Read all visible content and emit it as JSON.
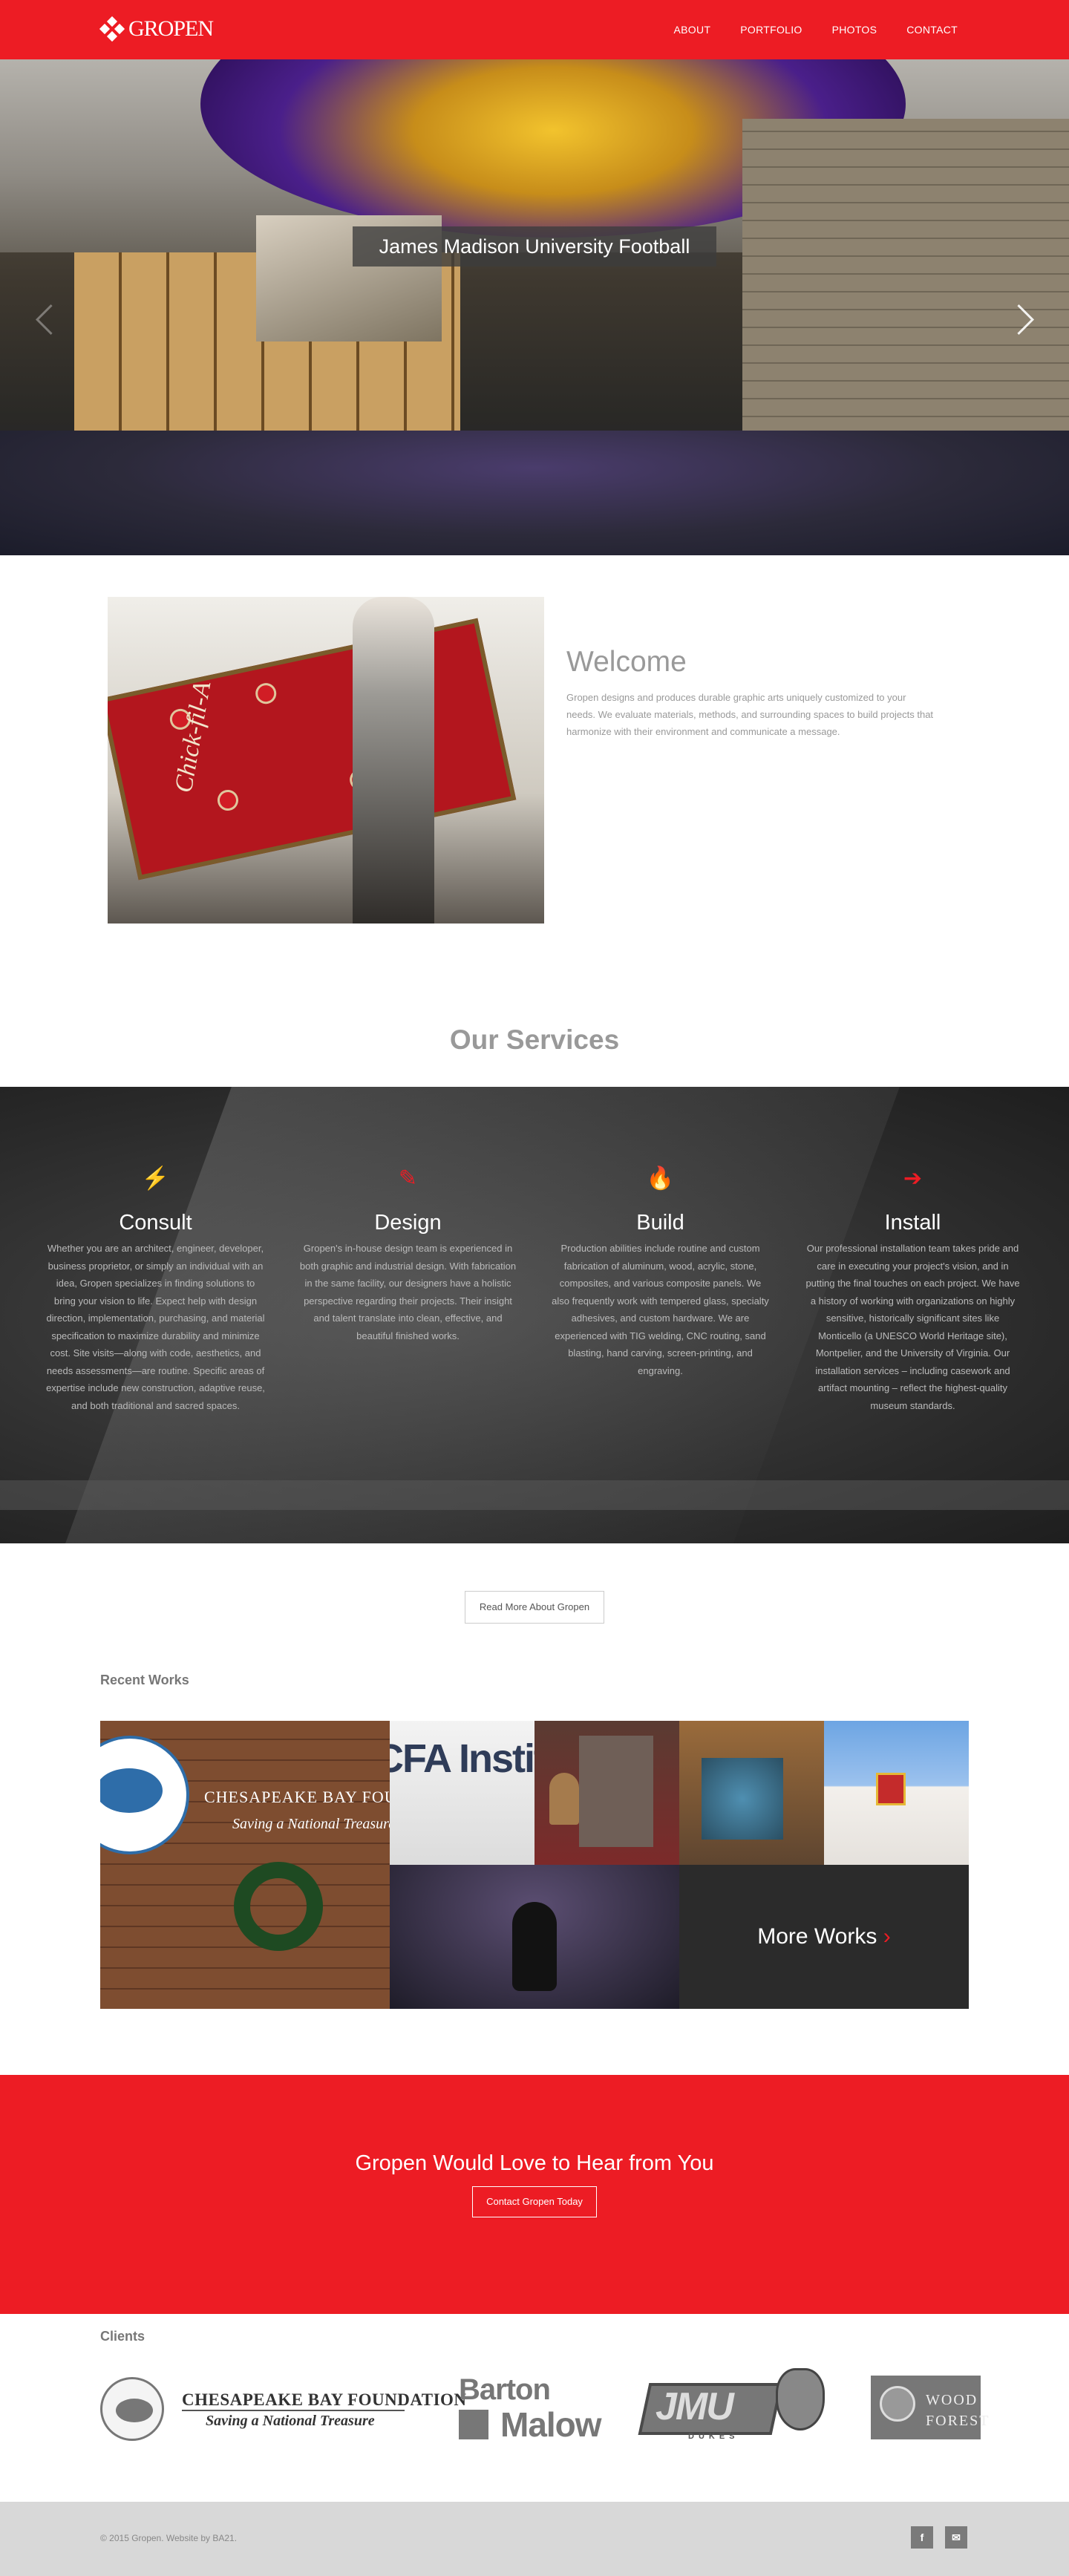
{
  "brand": {
    "name": "GROPEN",
    "accent_color": "#ed1c24"
  },
  "nav": {
    "items": [
      "ABOUT",
      "PORTFOLIO",
      "PHOTOS",
      "CONTACT"
    ]
  },
  "hero": {
    "caption": "James Madison University Football",
    "prev_icon": "chevron-left-icon",
    "next_icon": "chevron-right-icon"
  },
  "welcome": {
    "title": "Welcome",
    "text": "Gropen designs and produces durable graphic arts uniquely customized to your needs. We evaluate materials, methods, and surrounding spaces to build projects that harmonize with their environment and communicate a message.",
    "image_logo_text": "Chick-fil-A"
  },
  "services": {
    "title": "Our Services",
    "items": [
      {
        "icon": "lightning-icon",
        "glyph": "⚡",
        "title": "Consult",
        "text": "Whether you are an architect, engineer, developer, business proprietor, or simply an individual with an idea, Gropen specializes in finding solutions to bring your vision to life. Expect help with design direction, implementation, purchasing, and material specification to maximize durability and minimize cost. Site visits—along with code, aesthetics, and needs assessments—are routine. Specific areas of expertise include new construction, adaptive reuse, and both traditional and sacred spaces."
      },
      {
        "icon": "pencil-icon",
        "glyph": "✎",
        "title": "Design",
        "text": "Gropen's in-house design team is experienced in both graphic and industrial design. With fabrication in the same facility, our designers have a holistic perspective regarding their projects. Their insight and talent translate into clean, effective, and beautiful finished works."
      },
      {
        "icon": "fire-icon",
        "glyph": "🔥",
        "title": "Build",
        "text": "Production abilities include routine and custom fabrication of aluminum, wood, acrylic, stone, composites, and various composite panels. We also frequently work with tempered glass, specialty adhesives, and custom hardware. We are experienced with TIG welding, CNC routing, sand blasting, hand carving, screen-printing, and engraving."
      },
      {
        "icon": "sign-in-icon",
        "glyph": "➔",
        "title": "Install",
        "text": "Our professional installation team takes pride and care in executing your project's vision, and in putting the final touches on each project. We have a history of working with organizations on highly sensitive, historically significant sites like Monticello (a UNESCO World Heritage site), Montpelier, and the University of Virginia. Our installation services – including casework and artifact mounting – reflect the highest-quality museum standards."
      }
    ],
    "button_label": "Read More About Gropen"
  },
  "recent_works": {
    "title": "Recent Works",
    "tile1_name": "CHESAPEAKE BAY FOUNDATION",
    "tile1_sub": "Saving a National Treasure",
    "tile2_text": "CFA Institute",
    "more_label": "More Works",
    "more_chevron": "›"
  },
  "cta": {
    "title": "Gropen Would Love to Hear from You",
    "button_label": "Contact Gropen Today"
  },
  "clients": {
    "title": "Clients",
    "c1_name": "CHESAPEAKE BAY FOUNDATION",
    "c1_sub": "Saving a National Treasure",
    "c2_name_1": "Barton",
    "c2_name_2": "Malow",
    "c3_name": "JMU",
    "c3_sub": "DUKES",
    "c4_name_1": "WOOD",
    "c4_name_2": "FOREST"
  },
  "footer": {
    "copyright": "© 2015 Gropen. Website by BA21.",
    "social": [
      {
        "icon": "facebook-icon",
        "glyph": "f"
      },
      {
        "icon": "email-icon",
        "glyph": "✉"
      }
    ]
  }
}
